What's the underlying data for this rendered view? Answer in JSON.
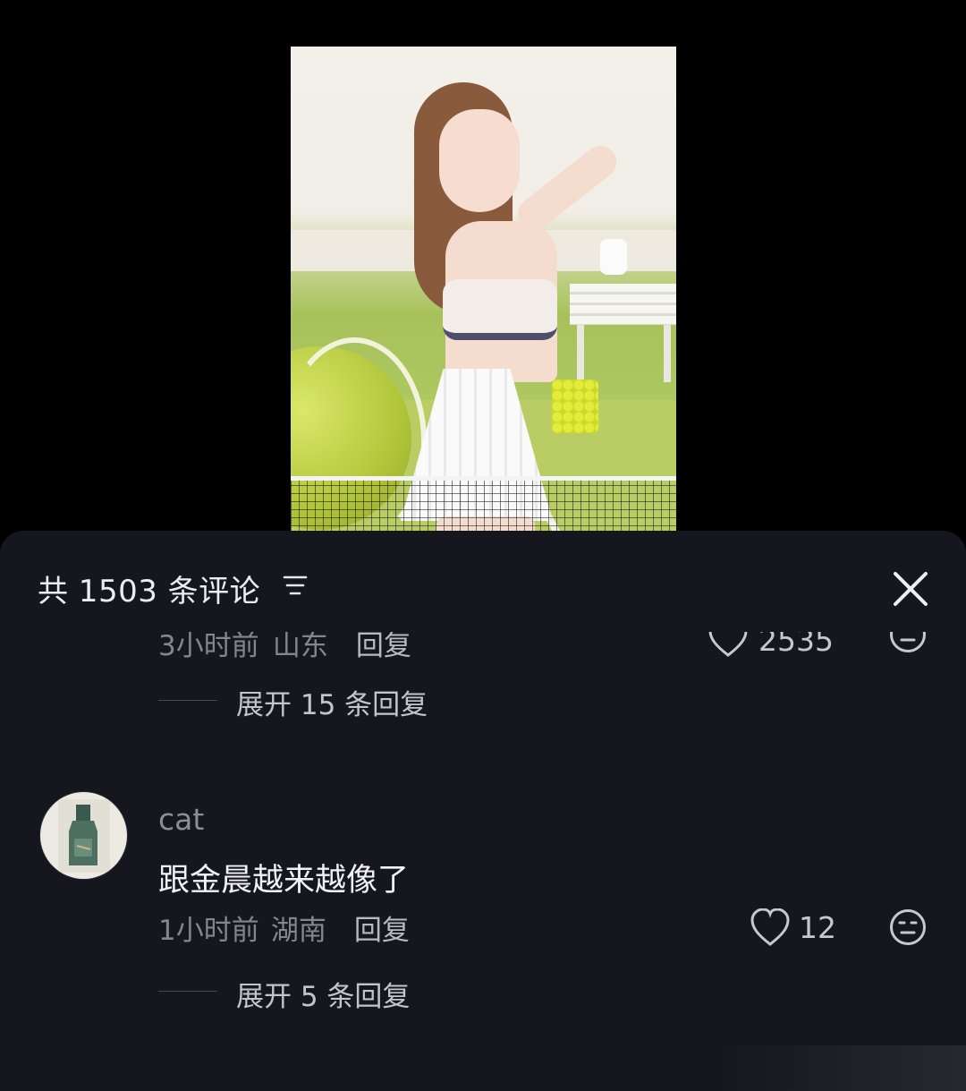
{
  "header": {
    "comment_count": "共 1503 条评论",
    "sort_icon": "filter-lines-icon",
    "close_icon": "close-icon"
  },
  "prev_comment": {
    "time": "3小时前",
    "location": "山东",
    "reply_label": "回复",
    "like_count": "2535",
    "expand_label": "展开 15 条回复"
  },
  "comment": {
    "username": "cat",
    "text": "跟金晨越来越像了",
    "time": "1小时前",
    "location": "湖南",
    "reply_label": "回复",
    "like_count": "12",
    "expand_label": "展开 5 条回复"
  },
  "colors": {
    "sheet_bg": "#16161e",
    "background": "#000000",
    "muted_text": "#85858f",
    "primary_text": "#f2f2f6"
  }
}
